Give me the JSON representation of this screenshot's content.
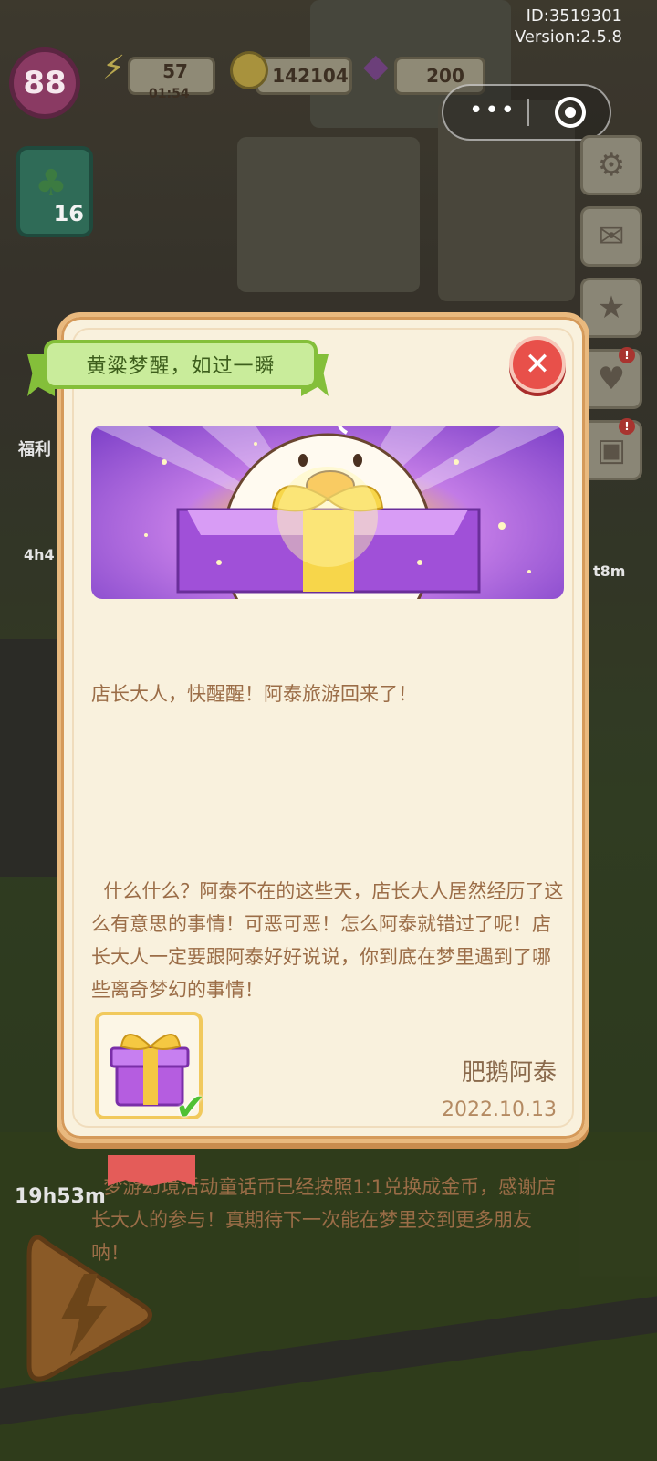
{
  "hud": {
    "id_text": "ID:3519301",
    "version_text": "Version:2.5.8",
    "level": "88",
    "energy": "57",
    "energy_timer": "01:54",
    "coins": "142104",
    "gems": "200",
    "left_card_count": "16"
  },
  "side_timers": {
    "timer_1": "4h4",
    "timer_2": "t8m",
    "timer_3": "19h53m",
    "label_fuli": "福利"
  },
  "dialog": {
    "title": "黄粱梦醒，如过一瞬",
    "paragraphs": [
      "店长大人，快醒醒！阿泰旅游回来了！",
      "  什么什么？阿泰不在的这些天，店长大人居然经历了这么有意思的事情！可恶可恶！怎么阿泰就错过了呢！店长大人一定要跟阿泰好好说说，你到底在梦里遇到了哪些离奇梦幻的事情！",
      "  梦游幻境活动童话币已经按照1:1兑换成金币，感谢店长大人的参与！真期待下一次能在梦里交到更多朋友呐！"
    ],
    "signer": "肥鹅阿泰",
    "date": "2022.10.13",
    "reward_claimed": true
  },
  "colors": {
    "banner_green": "#c9ec9b",
    "close_red": "#e8504a",
    "text_brown": "#9b6d47",
    "accent_purple": "#7b3fc7"
  }
}
